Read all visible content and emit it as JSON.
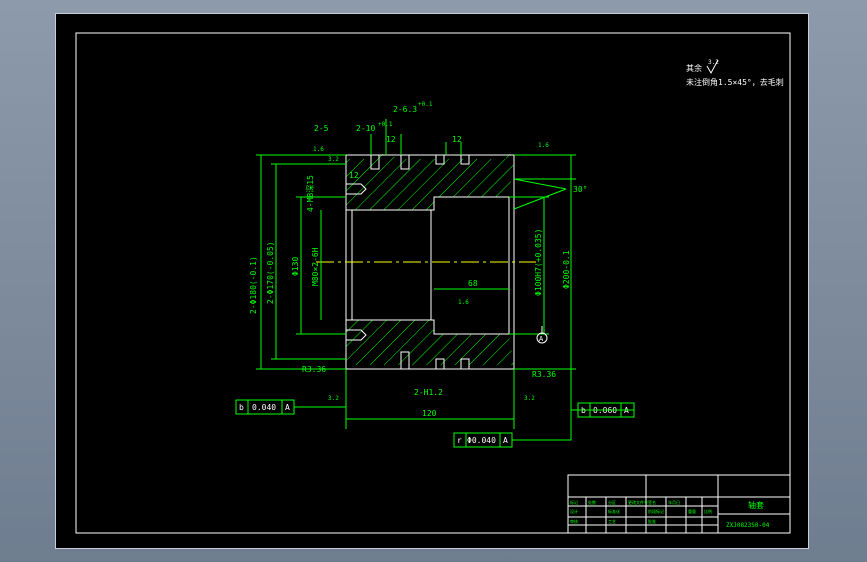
{
  "drawing": {
    "notes": {
      "line1": "其余",
      "line1_sym": "3.2",
      "line2": "未注倒角1.5×45°，去毛刺"
    },
    "dims": {
      "top_2_5": "2-5",
      "top_2_10": "2-10",
      "top_2_10_tol": "+0.1",
      "top_2_6_3": "2-6.3",
      "top_2_6_3_tol": "+0.1",
      "top_12a": "12",
      "top_12b": "12",
      "left_12": "12",
      "rough_1_6a": "1.6",
      "rough_3_2a": "3.2",
      "rough_1_6b": "1.6",
      "rough_1_6c": "1.6",
      "rough_3_2b": "3.2",
      "rough_3_2c": "3.2",
      "angle_30": "30°",
      "thread_hole": "4-M8深15",
      "d_outer_left": "2-Φ180(-0.1)",
      "d_groove": "2-Φ170(-0.05)",
      "d_130": "Φ130",
      "thread_main": "M80×2-6H",
      "d_100": "Φ100H7(+0.035)",
      "d_200": "Φ200-0.1",
      "len_68": "68",
      "len_120": "120",
      "r_left": "R3.36",
      "r_right": "R3.36",
      "groove_width": "2-H1.2",
      "datum_a": "A"
    },
    "tolerance_frames": [
      {
        "sym": "b",
        "value": "0.040",
        "datum": "A"
      },
      {
        "sym": "b",
        "value": "0.060",
        "datum": "A"
      },
      {
        "sym": "r",
        "value": "Φ0.040",
        "datum": "A"
      }
    ],
    "title_block": {
      "part_name": "轴套",
      "drawing_no": "ZXJ0823S0-04",
      "cells": [
        "标记",
        "处数",
        "分区",
        "更改文件号",
        "签名",
        "年月日",
        "设计",
        "标准化",
        "阶段标记",
        "重量",
        "比例",
        "审核",
        "工艺",
        "批准"
      ]
    }
  }
}
